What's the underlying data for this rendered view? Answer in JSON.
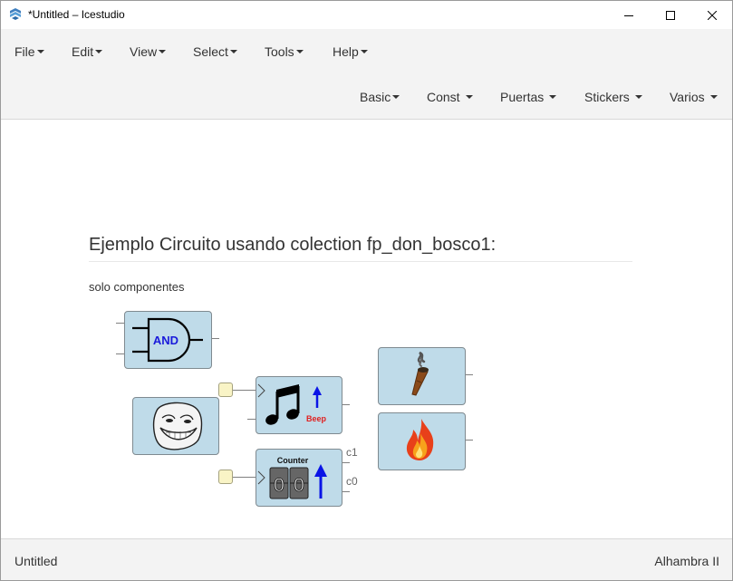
{
  "window": {
    "title": "*Untitled – Icestudio"
  },
  "menus": {
    "top": [
      {
        "label": "File"
      },
      {
        "label": "Edit"
      },
      {
        "label": "View"
      },
      {
        "label": "Select"
      },
      {
        "label": "Tools"
      },
      {
        "label": "Help"
      }
    ],
    "collections": [
      {
        "label": "Basic"
      },
      {
        "label": "Const"
      },
      {
        "label": "Puertas"
      },
      {
        "label": "Stickers"
      },
      {
        "label": "Varios"
      }
    ]
  },
  "canvas": {
    "heading": "Ejemplo Circuito usando colection fp_don_bosco1:",
    "subtext": "solo componentes",
    "blocks": {
      "and_label": "AND",
      "beep_label": "Beep",
      "counter_label": "Counter",
      "counter_digits": [
        "0",
        "0"
      ],
      "counter_ports": [
        "c1",
        "c0"
      ]
    }
  },
  "footer": {
    "project": "Untitled",
    "board": "Alhambra II"
  },
  "colors": {
    "block_fill": "#bfdbe9",
    "input_fill": "#f9f4c6",
    "chrome": "#f3f3f3"
  }
}
